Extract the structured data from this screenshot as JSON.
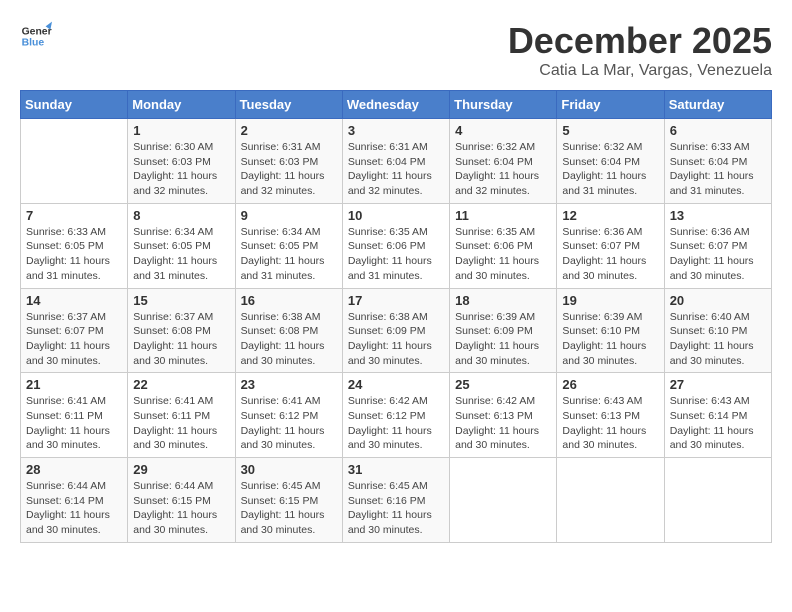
{
  "logo": {
    "line1": "General",
    "line2": "Blue"
  },
  "title": "December 2025",
  "subtitle": "Catia La Mar, Vargas, Venezuela",
  "weekdays": [
    "Sunday",
    "Monday",
    "Tuesday",
    "Wednesday",
    "Thursday",
    "Friday",
    "Saturday"
  ],
  "weeks": [
    [
      {
        "day": "",
        "info": ""
      },
      {
        "day": "1",
        "info": "Sunrise: 6:30 AM\nSunset: 6:03 PM\nDaylight: 11 hours\nand 32 minutes."
      },
      {
        "day": "2",
        "info": "Sunrise: 6:31 AM\nSunset: 6:03 PM\nDaylight: 11 hours\nand 32 minutes."
      },
      {
        "day": "3",
        "info": "Sunrise: 6:31 AM\nSunset: 6:04 PM\nDaylight: 11 hours\nand 32 minutes."
      },
      {
        "day": "4",
        "info": "Sunrise: 6:32 AM\nSunset: 6:04 PM\nDaylight: 11 hours\nand 32 minutes."
      },
      {
        "day": "5",
        "info": "Sunrise: 6:32 AM\nSunset: 6:04 PM\nDaylight: 11 hours\nand 31 minutes."
      },
      {
        "day": "6",
        "info": "Sunrise: 6:33 AM\nSunset: 6:04 PM\nDaylight: 11 hours\nand 31 minutes."
      }
    ],
    [
      {
        "day": "7",
        "info": "Sunrise: 6:33 AM\nSunset: 6:05 PM\nDaylight: 11 hours\nand 31 minutes."
      },
      {
        "day": "8",
        "info": "Sunrise: 6:34 AM\nSunset: 6:05 PM\nDaylight: 11 hours\nand 31 minutes."
      },
      {
        "day": "9",
        "info": "Sunrise: 6:34 AM\nSunset: 6:05 PM\nDaylight: 11 hours\nand 31 minutes."
      },
      {
        "day": "10",
        "info": "Sunrise: 6:35 AM\nSunset: 6:06 PM\nDaylight: 11 hours\nand 31 minutes."
      },
      {
        "day": "11",
        "info": "Sunrise: 6:35 AM\nSunset: 6:06 PM\nDaylight: 11 hours\nand 30 minutes."
      },
      {
        "day": "12",
        "info": "Sunrise: 6:36 AM\nSunset: 6:07 PM\nDaylight: 11 hours\nand 30 minutes."
      },
      {
        "day": "13",
        "info": "Sunrise: 6:36 AM\nSunset: 6:07 PM\nDaylight: 11 hours\nand 30 minutes."
      }
    ],
    [
      {
        "day": "14",
        "info": "Sunrise: 6:37 AM\nSunset: 6:07 PM\nDaylight: 11 hours\nand 30 minutes."
      },
      {
        "day": "15",
        "info": "Sunrise: 6:37 AM\nSunset: 6:08 PM\nDaylight: 11 hours\nand 30 minutes."
      },
      {
        "day": "16",
        "info": "Sunrise: 6:38 AM\nSunset: 6:08 PM\nDaylight: 11 hours\nand 30 minutes."
      },
      {
        "day": "17",
        "info": "Sunrise: 6:38 AM\nSunset: 6:09 PM\nDaylight: 11 hours\nand 30 minutes."
      },
      {
        "day": "18",
        "info": "Sunrise: 6:39 AM\nSunset: 6:09 PM\nDaylight: 11 hours\nand 30 minutes."
      },
      {
        "day": "19",
        "info": "Sunrise: 6:39 AM\nSunset: 6:10 PM\nDaylight: 11 hours\nand 30 minutes."
      },
      {
        "day": "20",
        "info": "Sunrise: 6:40 AM\nSunset: 6:10 PM\nDaylight: 11 hours\nand 30 minutes."
      }
    ],
    [
      {
        "day": "21",
        "info": "Sunrise: 6:41 AM\nSunset: 6:11 PM\nDaylight: 11 hours\nand 30 minutes."
      },
      {
        "day": "22",
        "info": "Sunrise: 6:41 AM\nSunset: 6:11 PM\nDaylight: 11 hours\nand 30 minutes."
      },
      {
        "day": "23",
        "info": "Sunrise: 6:41 AM\nSunset: 6:12 PM\nDaylight: 11 hours\nand 30 minutes."
      },
      {
        "day": "24",
        "info": "Sunrise: 6:42 AM\nSunset: 6:12 PM\nDaylight: 11 hours\nand 30 minutes."
      },
      {
        "day": "25",
        "info": "Sunrise: 6:42 AM\nSunset: 6:13 PM\nDaylight: 11 hours\nand 30 minutes."
      },
      {
        "day": "26",
        "info": "Sunrise: 6:43 AM\nSunset: 6:13 PM\nDaylight: 11 hours\nand 30 minutes."
      },
      {
        "day": "27",
        "info": "Sunrise: 6:43 AM\nSunset: 6:14 PM\nDaylight: 11 hours\nand 30 minutes."
      }
    ],
    [
      {
        "day": "28",
        "info": "Sunrise: 6:44 AM\nSunset: 6:14 PM\nDaylight: 11 hours\nand 30 minutes."
      },
      {
        "day": "29",
        "info": "Sunrise: 6:44 AM\nSunset: 6:15 PM\nDaylight: 11 hours\nand 30 minutes."
      },
      {
        "day": "30",
        "info": "Sunrise: 6:45 AM\nSunset: 6:15 PM\nDaylight: 11 hours\nand 30 minutes."
      },
      {
        "day": "31",
        "info": "Sunrise: 6:45 AM\nSunset: 6:16 PM\nDaylight: 11 hours\nand 30 minutes."
      },
      {
        "day": "",
        "info": ""
      },
      {
        "day": "",
        "info": ""
      },
      {
        "day": "",
        "info": ""
      }
    ]
  ]
}
